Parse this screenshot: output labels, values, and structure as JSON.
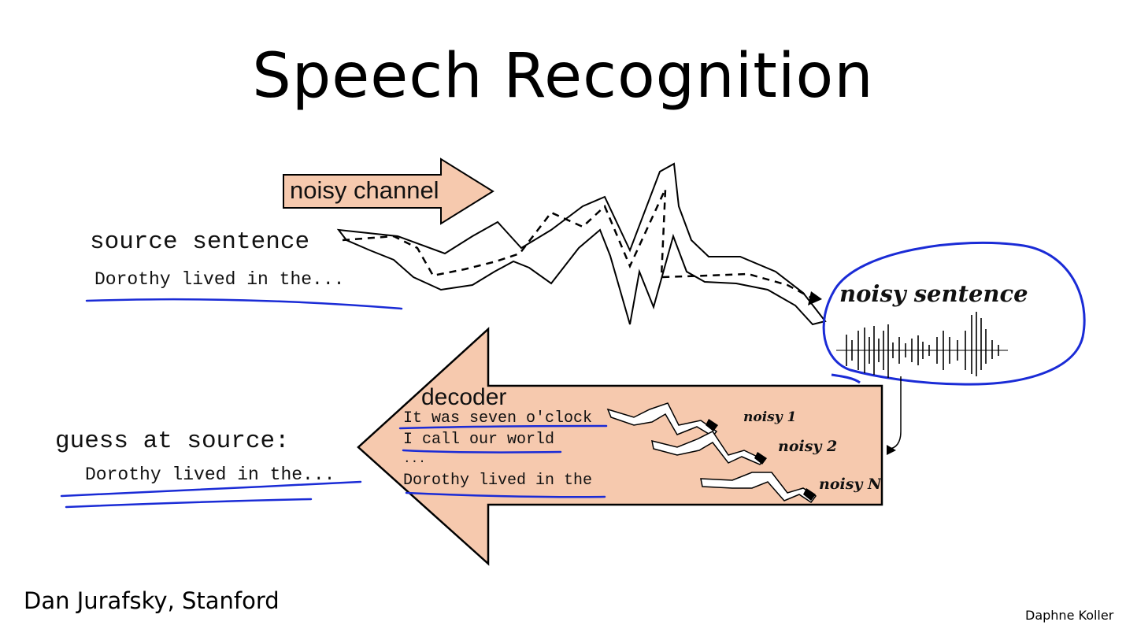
{
  "slide": {
    "title": "Speech Recognition",
    "channel_label": "noisy channel",
    "source_heading": "source sentence",
    "source_text": "Dorothy lived in the...",
    "noisy_label": "noisy sentence",
    "decoder_label": "decoder",
    "decoder_lines": [
      "It was seven o'clock",
      "I call our world",
      "...",
      "Dorothy lived in the"
    ],
    "noisy_tags": [
      "noisy 1",
      "noisy 2",
      "noisy N"
    ],
    "guess_heading": "guess at source:",
    "guess_text": "Dorothy lived in the...",
    "footer": "Dan Jurafsky, Stanford",
    "watermark": "Daphne Koller"
  },
  "colors": {
    "arrow_fill": "#f6c9ae",
    "ink_blue": "#1a2bd6",
    "outline": "#000000"
  }
}
